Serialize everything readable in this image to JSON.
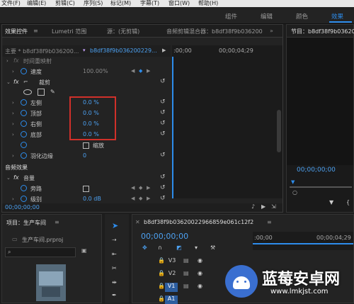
{
  "menubar": {
    "items": [
      "文件(F)",
      "编辑(E)",
      "剪辑(C)",
      "序列(S)",
      "标记(M)",
      "字幕(T)",
      "窗口(W)",
      "帮助(H)"
    ]
  },
  "workspace": {
    "tabs": [
      "组件",
      "编辑",
      "颜色",
      "效果"
    ],
    "active": "效果"
  },
  "effect_controls": {
    "tabs": [
      "效果控件",
      "Lumetri 范围",
      "源：(无剪辑)",
      "音频剪辑混合器：b8df38f9b036200"
    ],
    "master_label": "主要 * b8df38f9b036200...",
    "clip_label": "b8df38f9b036200229...",
    "timecode_ruler": [
      ":00;00",
      "00;00;04;29"
    ],
    "sections": {
      "time_remap": "时间重映射",
      "speed_label": "速度",
      "speed_value": "100.00%",
      "crop": "裁剪",
      "audio_effects": "音频效果",
      "volume": "音量",
      "bypass": "旁路",
      "level": "级别",
      "level_value": "0.0 dB"
    },
    "crop_params": [
      {
        "label": "左侧",
        "value": "0.0 %"
      },
      {
        "label": "顶部",
        "value": "0.0 %"
      },
      {
        "label": "右侧",
        "value": "0.0 %"
      },
      {
        "label": "底部",
        "value": "0.0 %"
      }
    ],
    "zoom_label": "缩放",
    "feather_label": "羽化边缘",
    "feather_value": "0",
    "current_time": "00;00;00;00"
  },
  "program": {
    "title": "节目：b8df38f9b036200",
    "timecode": "00;00;00;00"
  },
  "project": {
    "title": "项目：生产车间",
    "file": "生产车间.prproj"
  },
  "sequence": {
    "tab": "b8df38f9b03620022966859e061c12f2",
    "timecode": "00;00;00;00",
    "ruler": [
      ":00;00",
      "00;00;04;29"
    ],
    "tracks": [
      "V3",
      "V2",
      "V1",
      "A1"
    ],
    "active_track": "V1"
  },
  "watermark": {
    "brand": "蓝莓安卓网",
    "url": "www.lmkjst.com"
  }
}
